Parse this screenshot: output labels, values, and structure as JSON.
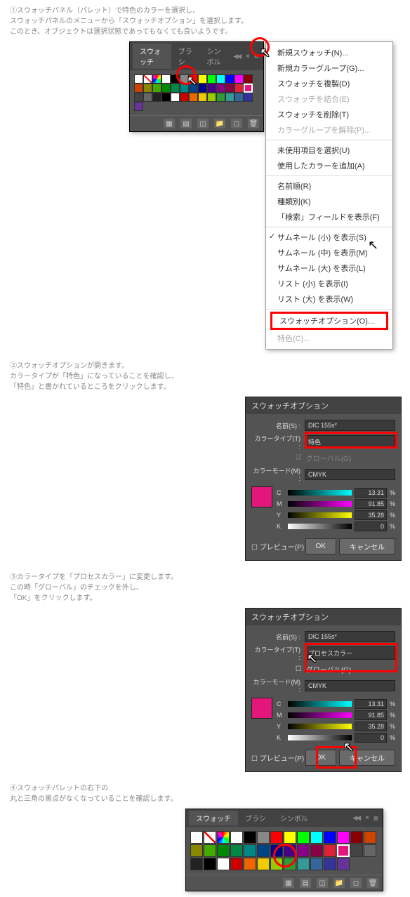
{
  "step1": {
    "text1": "①スウォッチパネル（パレット）で特色のカラーを選択し、",
    "text2": "スウォッチパネルのメニューから「スウォッチオプション」を選択します。",
    "text3": "このとき、オブジェクトは選択状態であってもなくても良いようです。"
  },
  "step2": {
    "text1": "②スウォッチオプションが開きます。",
    "text2": "カラータイプが「特色」になっていることを確認し、",
    "text3": "「特色」と書かれているところをクリックします。"
  },
  "step3": {
    "text1": "③カラータイプを「プロセスカラー」に変更します。",
    "text2": "この時「グローバル」のチェックを外し、",
    "text3": "「OK」をクリックします。"
  },
  "step4": {
    "text1": "④スウォッチパレットの右下の",
    "text2": "丸と三角の黒点がなくなっていることを確認します。"
  },
  "swatches": {
    "tab1": "スウォッチ",
    "tab2": "ブラシ",
    "tab3": "シンボル"
  },
  "menu": {
    "newSwatch": "新規スウォッチ(N)...",
    "newColorGroup": "新規カラーグループ(G)...",
    "duplicate": "スウォッチを複製(D)",
    "merge": "スウォッチを結合(E)",
    "delete": "スウォッチを削除(T)",
    "ungroupColor": "カラーグループを解除(P)...",
    "selectUnused": "未使用項目を選択(U)",
    "addUsed": "使用したカラーを追加(A)",
    "byName": "名前順(R)",
    "byKind": "種類別(K)",
    "showFind": "「検索」フィールドを表示(F)",
    "thumbS": "サムネール (小) を表示(S)",
    "thumbM": "サムネール (中) を表示(M)",
    "thumbL": "サムネール (大) を表示(L)",
    "listS": "リスト (小) を表示(I)",
    "listL": "リスト (大) を表示(W)",
    "options": "スウォッチオプション(O)...",
    "spot": "特色(C)..."
  },
  "dialog": {
    "title": "スウォッチオプション",
    "nameLabel": "名前(S) :",
    "nameValue": "DIC 155s*",
    "colorTypeLabel": "カラータイプ(T) :",
    "colorTypeSpot": "特色",
    "colorTypeProcess": "プロセスカラー",
    "globalLabel": "グローバル(G)",
    "colorModeLabel": "カラーモード(M) :",
    "colorModeValue": "CMYK",
    "c": "13.31",
    "m": "91.85",
    "y": "35.28",
    "k": "0",
    "preview": "プレビュー(P)",
    "ok": "OK",
    "cancel": "キャンセル",
    "checkmark": "✓"
  }
}
